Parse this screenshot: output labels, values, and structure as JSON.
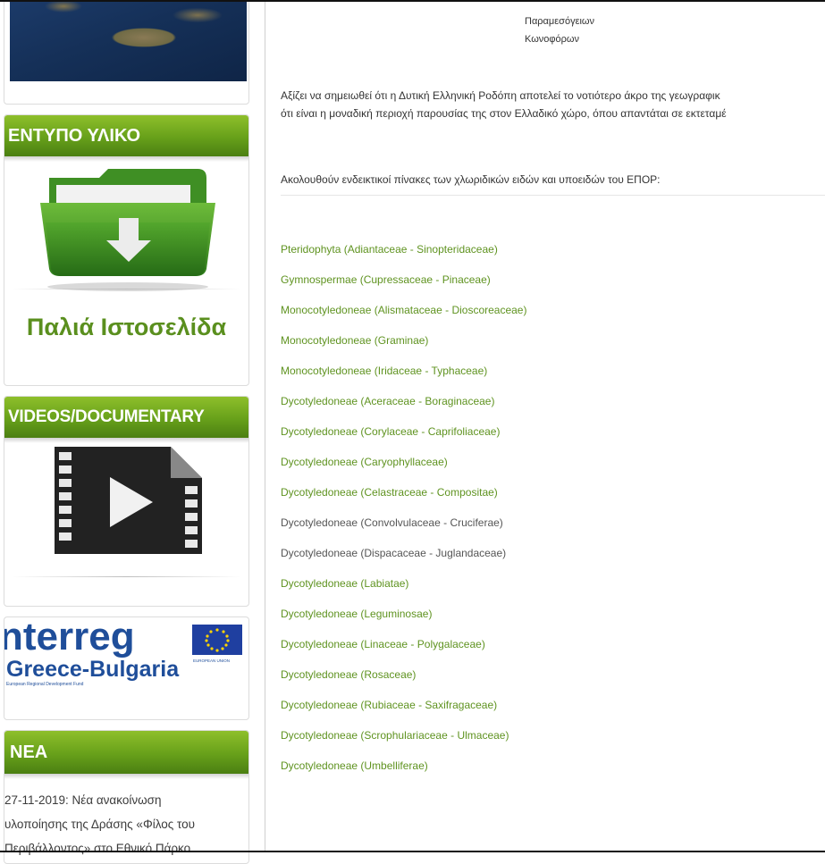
{
  "sidebar": {
    "print_material_title": "ΕΝΤΥΠΟ ΥΛΙΚΟ",
    "old_site_label": "Παλιά Ιστοσελίδα",
    "videos_title": "VIDEOS/DOCUMENTARY",
    "interreg": {
      "name": "Interreg",
      "program": "Greece-Bulgaria",
      "fund": "European Regional Development Fund",
      "eu_label": "EUROPEAN UNION"
    },
    "news_title": "ΝΕΑ",
    "news_lines": [
      "27-11-2019: Νέα ανακοίνωση",
      "υλοποίησης της Δράσης «Φίλος του",
      "Περιβάλλοντος» στο Εθνικό Πάρκο"
    ]
  },
  "main": {
    "table_lines": [
      "Παραμεσόγειων",
      "Κωνοφόρων"
    ],
    "paragraph_lines": [
      "Αξίζει να σημειωθεί ότι η Δυτική Ελληνική Ροδόπη αποτελεί το νοτιότερο άκρο της γεωγραφικ",
      "ότι είναι η μοναδική περιοχή παρουσίας της στον Ελλαδικό χώρο, όπου απαντάται σε εκτεταμέ"
    ],
    "intro": "Ακολουθούν ενδεικτικοί πίνακες των χλωριδικών ειδών και υποειδών του ΕΠΟΡ:",
    "species_links": [
      "Pteridophyta (Adiantaceae - Sinopteridaceae)",
      "Gymnospermae (Cupressaceae - Pinaceae)",
      "Monocotyledoneae (Alismataceae - Dioscoreaceae)",
      "Monocotyledoneae (Graminae)",
      "Monocotyledoneae (Iridaceae - Typhaceae)",
      "Dycotyledoneae (Aceraceae - Boraginaceae)",
      "Dycotyledoneae (Corylaceae - Caprifoliaceae)",
      "Dycotyledoneae (Caryophyllaceae)",
      "Dycotyledoneae (Celastraceae - Compositae)",
      "Dycotyledoneae (Convolvulaceae - Cruciferae)",
      "Dycotyledoneae (Dispacaceae - Juglandaceae)",
      "Dycotyledoneae (Labiatae)",
      "Dycotyledoneae (Leguminosae)",
      "Dycotyledoneae (Linaceae - Polygalaceae)",
      "Dycotyledoneae (Rosaceae)",
      "Dycotyledoneae (Rubiaceae - Saxifragaceae)",
      "Dycotyledoneae (Scrophulariaceae - Ulmaceae)",
      "Dycotyledoneae (Umbelliferae)"
    ]
  },
  "colors": {
    "accent_green": "#67a01a",
    "link_green": "#5f9320",
    "link_gray": "#555555"
  },
  "icons": [
    "folder-download-icon",
    "film-play-icon",
    "eu-flag-icon"
  ]
}
